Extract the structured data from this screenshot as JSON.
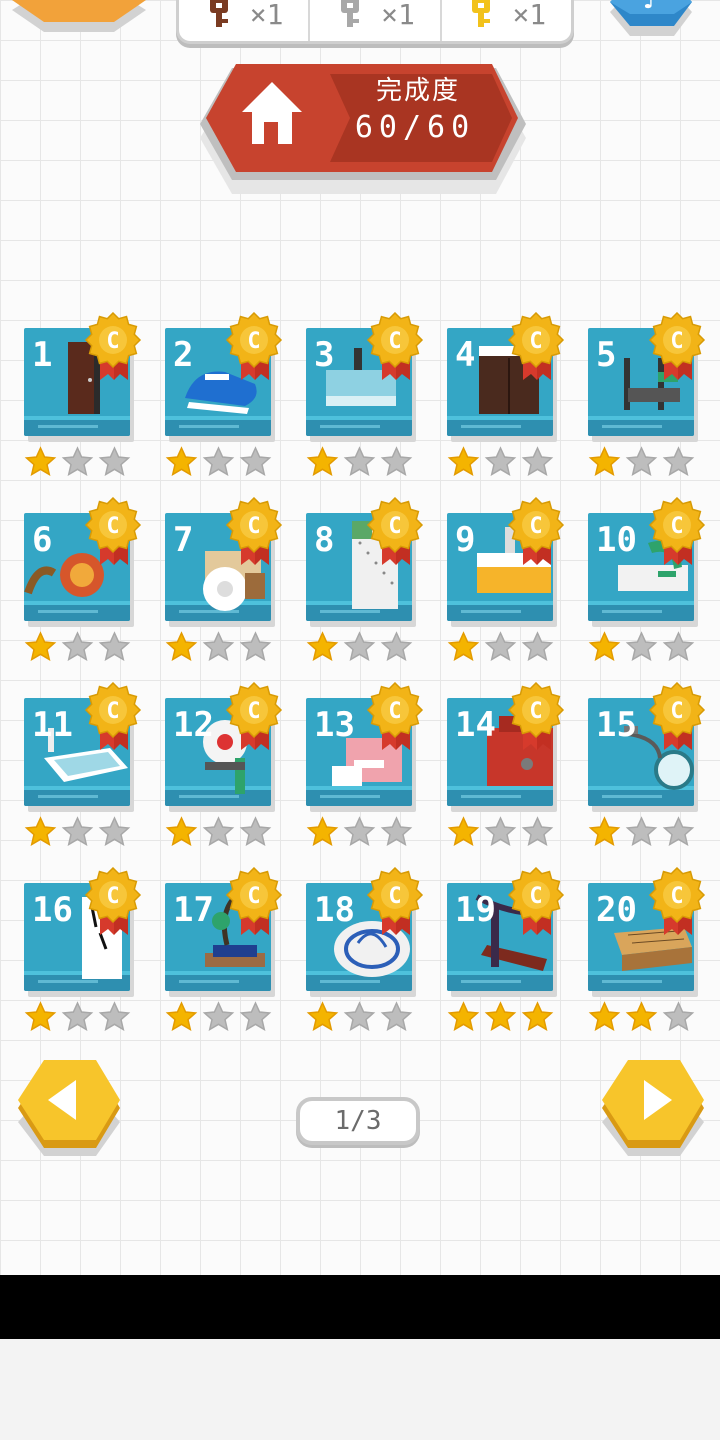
{
  "keys": [
    {
      "icon": "bronze-key-icon",
      "color": "#7a3b22",
      "count": "×1"
    },
    {
      "icon": "silver-key-icon",
      "color": "#a8a8a8",
      "count": "×1"
    },
    {
      "icon": "gold-key-icon",
      "color": "#f2c21b",
      "count": "×1"
    }
  ],
  "banner": {
    "title": "完成度",
    "value": "60/60"
  },
  "medal_letter": "C",
  "levels": [
    {
      "num": "1",
      "stars": 1
    },
    {
      "num": "2",
      "stars": 1
    },
    {
      "num": "3",
      "stars": 1
    },
    {
      "num": "4",
      "stars": 1
    },
    {
      "num": "5",
      "stars": 1
    },
    {
      "num": "6",
      "stars": 1
    },
    {
      "num": "7",
      "stars": 1
    },
    {
      "num": "8",
      "stars": 1
    },
    {
      "num": "9",
      "stars": 1
    },
    {
      "num": "10",
      "stars": 1
    },
    {
      "num": "11",
      "stars": 1
    },
    {
      "num": "12",
      "stars": 1
    },
    {
      "num": "13",
      "stars": 1
    },
    {
      "num": "14",
      "stars": 1
    },
    {
      "num": "15",
      "stars": 1
    },
    {
      "num": "16",
      "stars": 1
    },
    {
      "num": "17",
      "stars": 1
    },
    {
      "num": "18",
      "stars": 1
    },
    {
      "num": "19",
      "stars": 3
    },
    {
      "num": "20",
      "stars": 2
    }
  ],
  "pagination": {
    "label": "1/3"
  },
  "colors": {
    "gold": "#f4b400",
    "teal": "#34a6c5",
    "red": "#c9412c",
    "hex_orange": "#f5a524",
    "hex_blue": "#2e87c9",
    "star_gray": "#bdbdbd"
  }
}
